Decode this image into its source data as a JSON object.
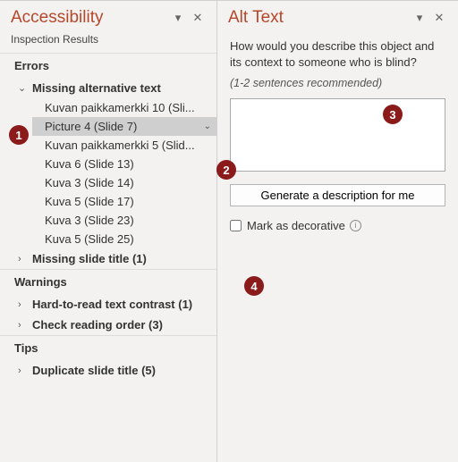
{
  "accessibility": {
    "title": "Accessibility",
    "subhead": "Inspection Results",
    "sections": {
      "errors": "Errors",
      "warnings": "Warnings",
      "tips": "Tips"
    },
    "groups": {
      "missing_alt": "Missing alternative text",
      "missing_slide_title": "Missing slide title (1)",
      "hard_to_read": "Hard-to-read text contrast (1)",
      "check_reading_order": "Check reading order (3)",
      "duplicate_slide_title": "Duplicate slide title (5)"
    },
    "missing_alt_items": [
      "Kuvan paikkamerkki 10  (Sli...",
      "Picture 4  (Slide 7)",
      "Kuvan paikkamerkki 5  (Slid...",
      "Kuva 6  (Slide 13)",
      "Kuva 3  (Slide 14)",
      "Kuva 5  (Slide 17)",
      "Kuva 3  (Slide 23)",
      "Kuva 5  (Slide 25)"
    ]
  },
  "alt_text": {
    "title": "Alt Text",
    "desc": "How would you describe this object and its context to someone who is blind?",
    "hint": "(1-2 sentences recommended)",
    "value": "",
    "generate_btn": "Generate a description for me",
    "decorative_label": "Mark as decorative"
  },
  "callouts": {
    "c1": "1",
    "c2": "2",
    "c3": "3",
    "c4": "4"
  }
}
